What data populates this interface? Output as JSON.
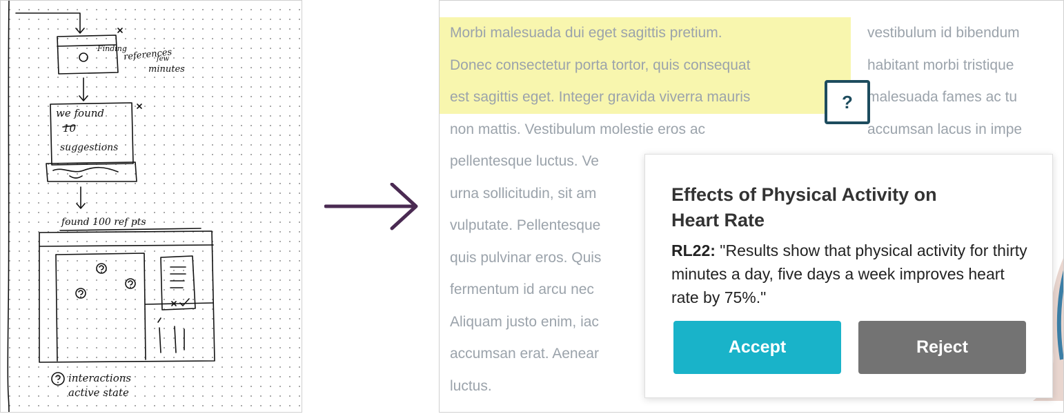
{
  "sketch": {
    "card1": {
      "line1": "Finding",
      "line2": "references",
      "line3": "few",
      "line4": "minutes"
    },
    "card2": {
      "line1": "we found",
      "line2": "10",
      "line3": "suggestions"
    },
    "screen_caption": "found 100 ref pts",
    "footnote_line1": "interactions",
    "footnote_line2": "active state"
  },
  "mockup": {
    "left_column": [
      "Morbi malesuada dui eget sagittis pretium.",
      "Donec consectetur porta tortor, quis consequat",
      "est sagittis eget. Integer gravida viverra mauris",
      "non mattis. Vestibulum molestie eros ac",
      "pellentesque luctus. Ve",
      "urna sollicitudin, sit am",
      "vulputate. Pellentesque",
      "quis pulvinar eros. Quis",
      "fermentum id arcu nec",
      "Aliquam justo enim, iac",
      "accumsan erat. Aenear",
      "luctus."
    ],
    "right_column": [
      "vestibulum id bibendum",
      "habitant morbi tristique",
      "malesuada fames ac tu",
      "accumsan lacus in impe"
    ],
    "help_button_label": "?",
    "popover": {
      "title": "Effects of Physical Activity on Heart Rate",
      "code": "RL22:",
      "quote": "\"Results show that physical activity for thirty minutes a day, five days a week improves heart rate by 75%.\"",
      "accept_label": "Accept",
      "reject_label": "Reject"
    }
  },
  "colors": {
    "highlight": "#f8f6ae",
    "help_border": "#1d4c5e",
    "accept": "#19b3c9",
    "reject": "#737373",
    "arrow": "#4a2a52",
    "body_text": "#9ba3ab"
  }
}
